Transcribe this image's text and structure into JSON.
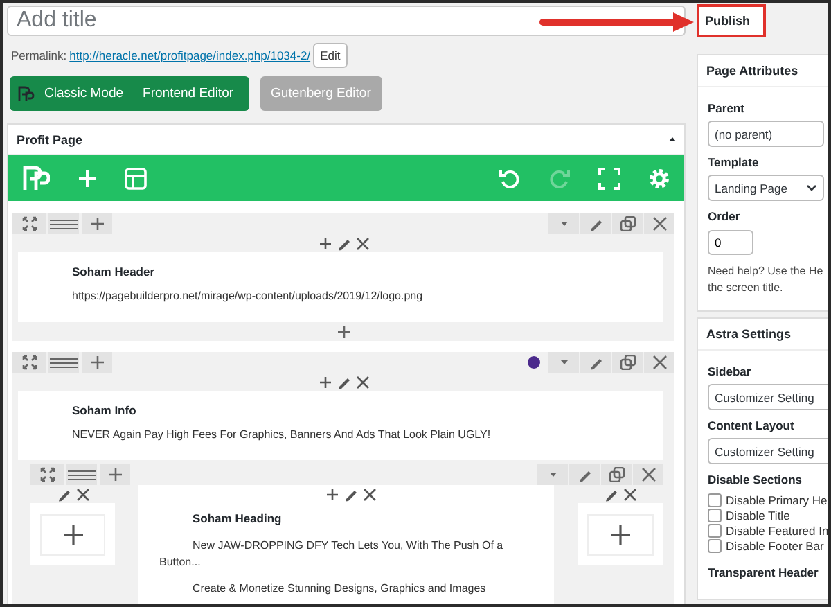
{
  "title_field": {
    "placeholder": "Add title"
  },
  "permalink": {
    "label": "Permalink:",
    "url": "http://heracle.net/profitpage/index.php/1034-2/",
    "edit_button": "Edit"
  },
  "editor_buttons": [
    {
      "label": "Classic Mode",
      "kind": "green"
    },
    {
      "label": "Frontend Editor",
      "kind": "green"
    },
    {
      "label": "Gutenberg Editor",
      "kind": "grey"
    }
  ],
  "builder": {
    "title": "Profit Page",
    "toolbar_left": [
      {
        "kind": "logo"
      },
      {
        "kind": "add"
      },
      {
        "kind": "layout"
      }
    ],
    "toolbar_right": [
      {
        "kind": "undo",
        "disabled": false
      },
      {
        "kind": "redo",
        "disabled": true
      },
      {
        "kind": "fullscreen",
        "disabled": false
      },
      {
        "kind": "settings",
        "disabled": false
      }
    ],
    "rows": [
      {
        "elements": [
          {
            "title": "Soham Header",
            "lines": [
              "https://pagebuilderpro.net/mirage/wp-content/uploads/2019/12/logo.png"
            ]
          }
        ]
      },
      {
        "color": "#4b2a8c",
        "elements": [
          {
            "title": "Soham Info",
            "lines": [
              "NEVER Again Pay High Fees For Graphics, Banners And Ads That Look Plain UGLY!"
            ]
          }
        ],
        "inner_row": {
          "columns": [
            {
              "kind": "empty"
            },
            {
              "kind": "content",
              "title": "Soham Heading",
              "lines": [
                "New JAW-DROPPING DFY Tech Lets You, With The Push Of a Button...",
                "Create & Monetize Stunning Designs, Graphics and Images"
              ]
            },
            {
              "kind": "empty"
            }
          ]
        }
      }
    ]
  },
  "sidebar": {
    "publish": "Publish",
    "page_attributes": {
      "title": "Page Attributes",
      "parent_label": "Parent",
      "parent_value": "(no parent)",
      "template_label": "Template",
      "template_value": "Landing Page",
      "order_label": "Order",
      "order_value": "0",
      "help_lines": [
        "Need help? Use the He",
        "the screen title."
      ]
    },
    "astra": {
      "title": "Astra Settings",
      "sidebar_label": "Sidebar",
      "sidebar_value": "Customizer Setting",
      "layout_label": "Content Layout",
      "layout_value": "Customizer Setting",
      "disable_label": "Disable Sections",
      "checkboxes": [
        {
          "label": "Disable Primary He",
          "checked": false
        },
        {
          "label": "Disable Title",
          "checked": false
        },
        {
          "label": "Disable Featured In",
          "checked": false
        },
        {
          "label": "Disable Footer Bar",
          "checked": false
        }
      ],
      "transparent_label": "Transparent Header"
    }
  }
}
